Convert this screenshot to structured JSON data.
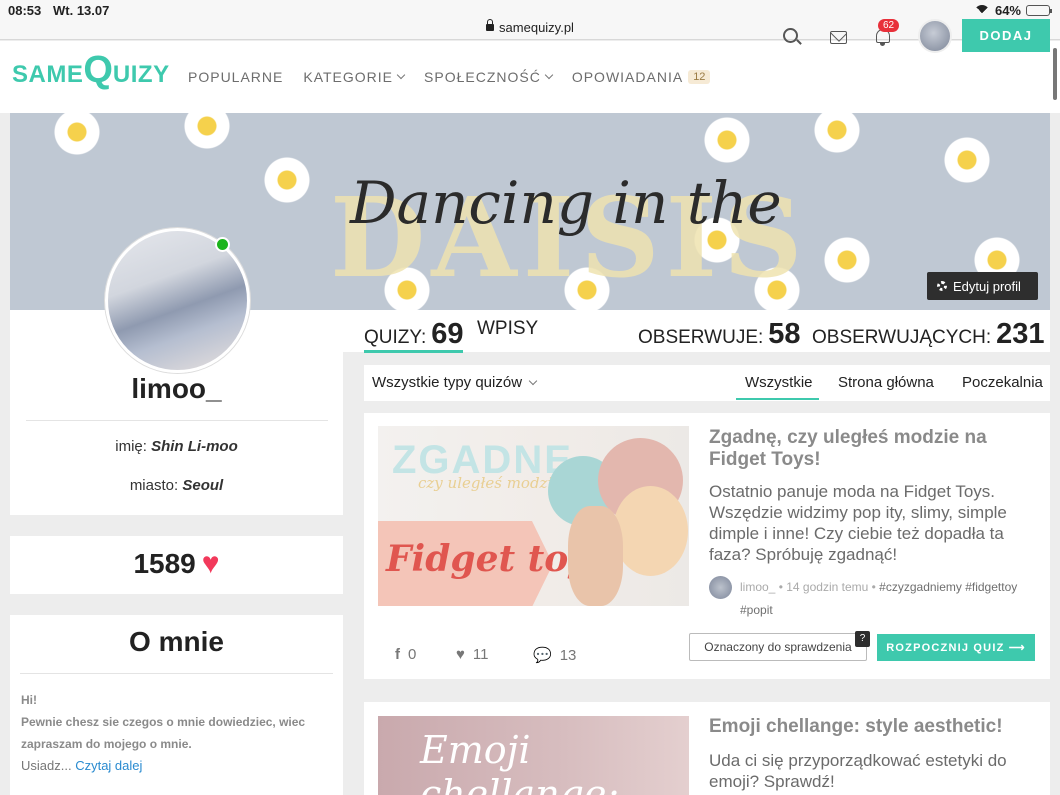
{
  "statusbar": {
    "time": "08:53",
    "date": "Wt. 13.07",
    "url": "samequizy.pl",
    "battery": "64%",
    "battery_level": 0.64
  },
  "nav": {
    "logo": {
      "part1": "SAME",
      "part2": "Q",
      "part3": "UIZY"
    },
    "menu": {
      "popularne": "POPULARNE",
      "kategorie": "KATEGORIE",
      "spolecznosc": "SPOŁECZNOŚĆ",
      "opowiadania": "OPOWIADANIA",
      "opowiadania_badge": "12"
    },
    "notifications_count": "62",
    "add_button": "DODAJ",
    "accent_color": "#3ec9ad"
  },
  "banner": {
    "script_text": "Dancing in the",
    "big_text": "DAISIS",
    "edit_profile": "Edytuj profil"
  },
  "profile": {
    "username": "limoo_",
    "name_label": "imię:",
    "name_value": "Shin Li-moo",
    "city_label": "miasto:",
    "city_value": "Seoul",
    "likes": "1589",
    "about_title": "O mnie",
    "about_line1": "Hi!",
    "about_line2": "Pewnie chesz sie czegos o mnie dowiedziec, wiec",
    "about_line3": "zapraszam do mojego o mnie.",
    "about_line4": "Usiadz...",
    "read_more": "Czytaj dalej"
  },
  "stats": {
    "quizy_label": "QUIZY:",
    "quizy_count": "69",
    "wpisy_label": "WPISY",
    "obserwuje_label": "OBSERWUJE:",
    "obserwuje_count": "58",
    "obserwujacych_label": "OBSERWUJĄCYCH:",
    "obserwujacych_count": "231"
  },
  "filter": {
    "type_select": "Wszystkie typy quizów",
    "tabs": [
      "Wszystkie",
      "Strona główna",
      "Poczekalnia"
    ]
  },
  "quizzes": [
    {
      "title": "Zgadnę, czy uległeś modzie na Fidget Toys!",
      "description": "Ostatnio panuje moda na Fidget Toys. Wszędzie widzimy pop ity, slimy, simple dimple i inne! Czy ciebie też dopadła ta faza? Spróbuję zgadnąć!",
      "author": "limoo_",
      "time": "14 godzin temu",
      "tags_line1": "#czyzgadniemy #fidgettoy",
      "tags_line2": "#popit",
      "thumb_title": "ZGADNĘ",
      "thumb_sub": "czy uległeś modzie na",
      "thumb_main": "Fidget toys!",
      "shares": "0",
      "likes": "11",
      "comments": "13",
      "check_button": "Oznaczony do sprawdzenia",
      "check_badge": "?",
      "start_button": "ROZPOCZNIJ QUIZ ⟶"
    },
    {
      "title": "Emoji chellange: style aesthetic!",
      "description": "Uda ci się przyporządkować estetyki do emoji? Sprawdź!",
      "thumb_title": "Emoji chellange:"
    }
  ]
}
